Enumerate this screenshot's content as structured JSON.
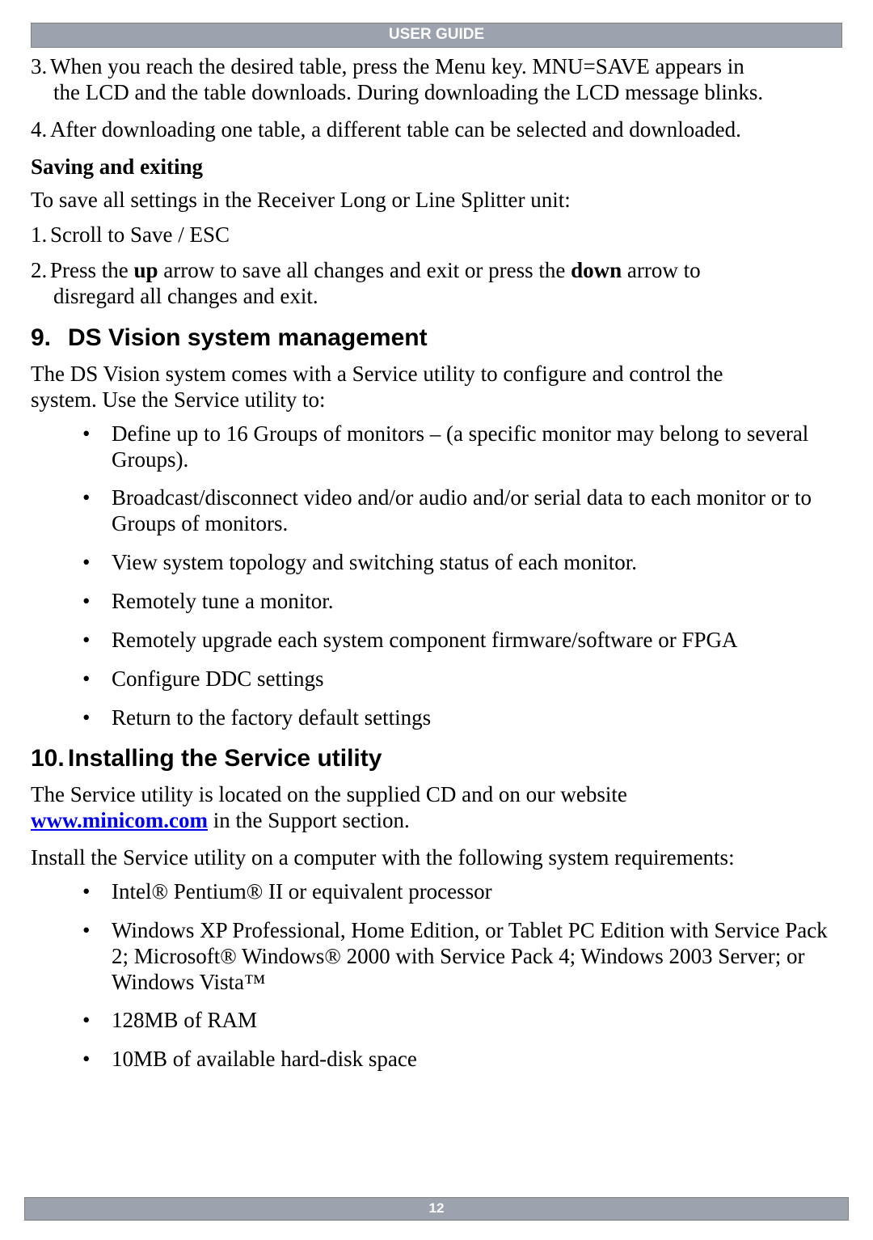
{
  "header": {
    "title": "USER GUIDE"
  },
  "steps_top": [
    {
      "number": "3.",
      "text_a": "When you reach the desired table, press the Menu key. MNU=SAVE appears in",
      "text_b": "the LCD and the table downloads. During downloading the LCD message blinks."
    },
    {
      "number": "4.",
      "text_a": "After downloading one table, a different table can be selected and downloaded.",
      "text_b": ""
    }
  ],
  "saving": {
    "heading": "Saving and exiting",
    "intro": "To save all settings in the Receiver Long or Line Splitter unit:",
    "steps": [
      {
        "number": "1.",
        "text": "Scroll to Save / ESC"
      },
      {
        "number": "2.",
        "pre": "Press the ",
        "bold1": "up",
        "mid": " arrow to save all changes and exit or press the ",
        "bold2": "down",
        "post": " arrow to",
        "line2": "disregard all changes and exit."
      }
    ]
  },
  "section9": {
    "num": "9.",
    "title": "DS Vision system management",
    "intro1": "The DS Vision system comes with a Service utility to configure and control the",
    "intro2": "system. Use the Service utility to:",
    "bullets": [
      "Define up to 16 Groups of monitors – (a specific monitor may belong to several Groups).",
      "Broadcast/disconnect video and/or audio and/or serial data to each monitor or to Groups of monitors.",
      "View system topology and switching status of each monitor.",
      "Remotely tune a monitor.",
      "Remotely upgrade each system component firmware/software or FPGA",
      "Configure DDC settings",
      "Return to the factory default settings"
    ]
  },
  "section10": {
    "num": "10.",
    "title": "Installing the Service utility",
    "intro_pre": "The Service utility is located on the supplied CD and on our website ",
    "link_text": "www.minicom.com",
    "intro_post": " in the Support section.",
    "req_line": "Install the Service utility on a computer with the following system requirements:",
    "bullets": [
      "Intel® Pentium® II or equivalent processor",
      "Windows XP Professional, Home Edition, or Tablet PC Edition with Service Pack 2; Microsoft® Windows® 2000 with Service Pack 4; Windows 2003 Server; or Windows Vista™",
      "128MB of RAM",
      "10MB of available hard-disk space"
    ]
  },
  "footer": {
    "page": "12"
  }
}
